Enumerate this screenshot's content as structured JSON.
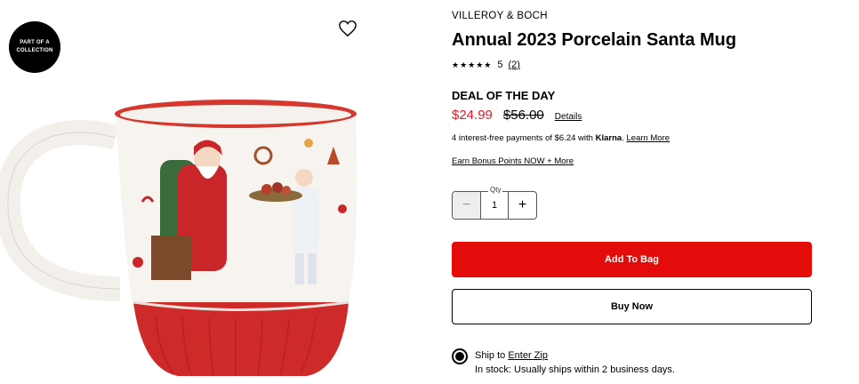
{
  "badge": {
    "text": "PART OF A COLLECTION"
  },
  "product": {
    "brand": "VILLEROY & BOCH",
    "title": "Annual 2023 Porcelain Santa Mug",
    "rating_stars": "★★★★★",
    "rating_value": "5",
    "review_count": "(2)",
    "deal_label": "DEAL OF THE DAY",
    "sale_price": "$24.99",
    "original_price": "$56.00",
    "details_link": "Details",
    "installments_prefix": "4 interest-free payments of $6.24 with ",
    "installments_brand": "Klarna",
    "installments_dot": ". ",
    "installments_link": "Learn More",
    "bonus_link": "Earn Bonus Points NOW + More"
  },
  "quantity": {
    "label": "Qty",
    "value": "1",
    "minus": "−",
    "plus": "+"
  },
  "buttons": {
    "add_to_bag": "Add To Bag",
    "buy_now": "Buy Now"
  },
  "shipping": {
    "prefix": "Ship to ",
    "zip_link": "Enter Zip",
    "stock": "In stock: Usually ships within 2 business days."
  },
  "colors": {
    "sale": "#e01a2b",
    "add_to_bag_bg": "#e40b0b"
  },
  "icons": {
    "wishlist": "heart-outline-icon"
  }
}
